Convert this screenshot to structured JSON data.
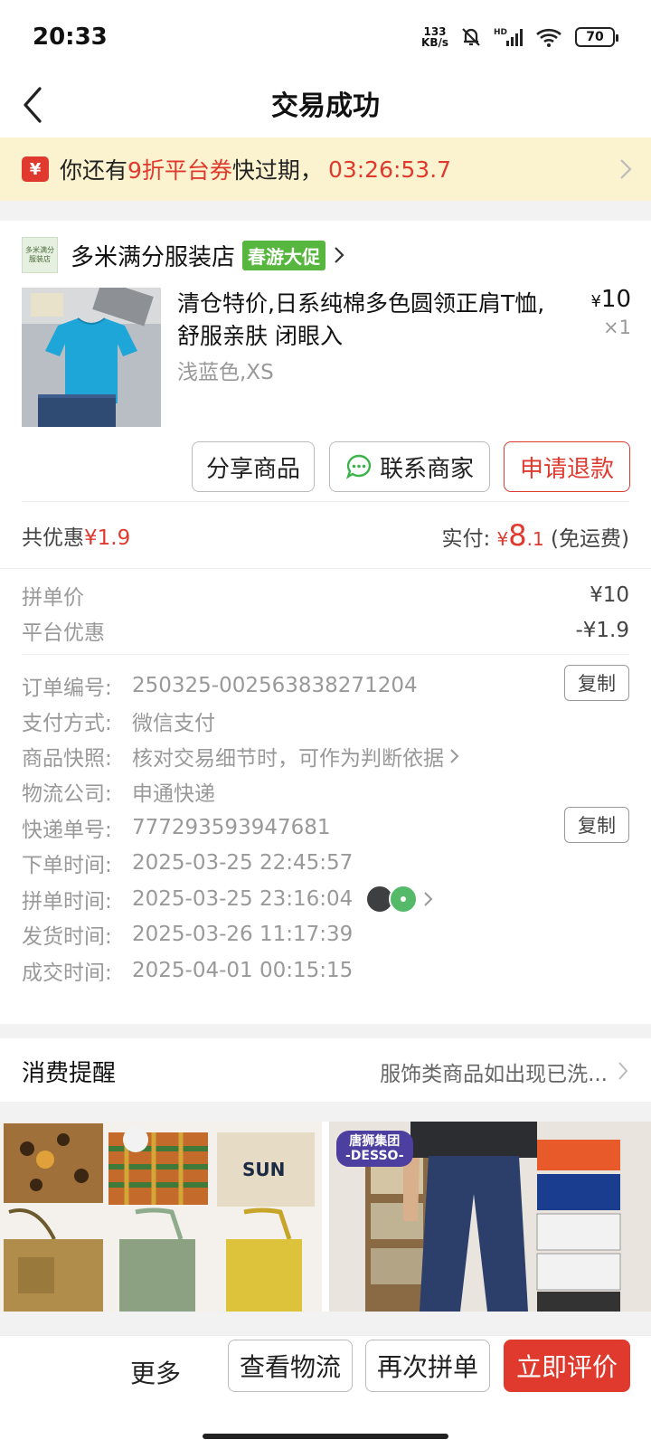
{
  "status_bar": {
    "time": "20:33",
    "speed_value": "133",
    "speed_unit": "KB/s",
    "battery": "70"
  },
  "header": {
    "title": "交易成功"
  },
  "coupon_banner": {
    "icon_char": "¥",
    "prefix": "你还有",
    "highlight": "9折平台券",
    "suffix": "快过期，",
    "countdown": "03:26:53.7"
  },
  "shop": {
    "logo_text": "多米满分服装店",
    "name": "多米满分服装店",
    "promo_tag": "春游大促"
  },
  "product": {
    "name": "清仓特价,日系纯棉多色圆领正肩T恤,舒服亲肤 闭眼入",
    "spec": "浅蓝色,XS",
    "price_symbol": "¥",
    "price": "10",
    "quantity": "×1"
  },
  "actions": {
    "share": "分享商品",
    "contact": "联系商家",
    "refund": "申请退款"
  },
  "summary": {
    "discount_label": "共优惠",
    "discount_value": "¥1.9",
    "paid_label": "实付:",
    "paid_symbol": "¥",
    "paid_int": "8",
    "paid_dec": ".1",
    "shipping_note": "(免运费)"
  },
  "price_details": [
    {
      "label": "拼单价",
      "value": "¥10"
    },
    {
      "label": "平台优惠",
      "value": "-¥1.9"
    }
  ],
  "order_info": {
    "order_no": {
      "label": "订单编号:",
      "value": "250325-002563838271204",
      "copy": "复制"
    },
    "payment": {
      "label": "支付方式:",
      "value": "微信支付"
    },
    "snapshot": {
      "label": "商品快照:",
      "value": "核对交易细节时，可作为判断依据"
    },
    "courier": {
      "label": "物流公司:",
      "value": "申通快递"
    },
    "tracking": {
      "label": "快递单号:",
      "value": "777293593947681",
      "copy": "复制"
    },
    "order_time": {
      "label": "下单时间:",
      "value": "2025-03-25 22:45:57"
    },
    "group_time": {
      "label": "拼单时间:",
      "value": "2025-03-25 23:16:04"
    },
    "ship_time": {
      "label": "发货时间:",
      "value": "2025-03-26 11:17:39"
    },
    "deal_time": {
      "label": "成交时间:",
      "value": "2025-04-01 00:15:15"
    }
  },
  "reminder": {
    "title": "消费提醒",
    "text": "服饰类商品如出现已洗..."
  },
  "recommendations": {
    "right_badge_line1": "唐狮集团",
    "right_badge_line2": "-DESSO-",
    "bag_text": "SUN"
  },
  "bottom_bar": {
    "more": "更多",
    "logistics": "查看物流",
    "reorder": "再次拼单",
    "review": "立即评价"
  },
  "colors": {
    "accent_red": "#e03a2f",
    "promo_green": "#56b63d",
    "banner_bg": "#fbf3cf"
  }
}
